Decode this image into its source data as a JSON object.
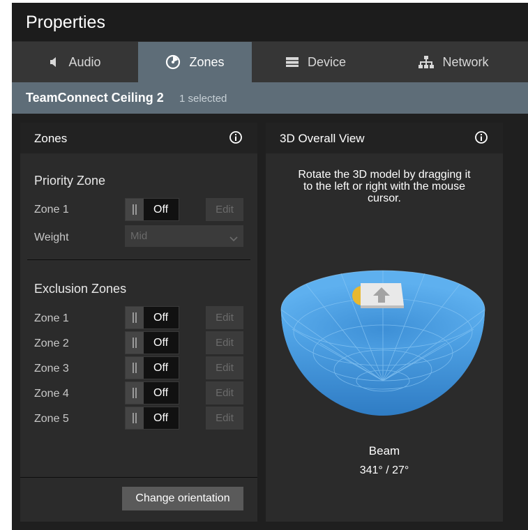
{
  "header": {
    "title": "Properties"
  },
  "tabs": [
    {
      "label": "Audio",
      "icon": "speaker-icon",
      "active": false
    },
    {
      "label": "Zones",
      "icon": "zones-icon",
      "active": true
    },
    {
      "label": "Device",
      "icon": "device-icon",
      "active": false
    },
    {
      "label": "Network",
      "icon": "network-icon",
      "active": false
    }
  ],
  "selection": {
    "device": "TeamConnect Ceiling 2",
    "count": "1 selected"
  },
  "zones_panel": {
    "title": "Zones",
    "priority": {
      "title": "Priority Zone",
      "zone_label": "Zone 1",
      "toggle": "Off",
      "edit": "Edit",
      "weight_label": "Weight",
      "weight_value": "Mid"
    },
    "exclusion": {
      "title": "Exclusion Zones",
      "zones": [
        {
          "label": "Zone 1",
          "toggle": "Off",
          "edit": "Edit"
        },
        {
          "label": "Zone 2",
          "toggle": "Off",
          "edit": "Edit"
        },
        {
          "label": "Zone 3",
          "toggle": "Off",
          "edit": "Edit"
        },
        {
          "label": "Zone 4",
          "toggle": "Off",
          "edit": "Edit"
        },
        {
          "label": "Zone 5",
          "toggle": "Off",
          "edit": "Edit"
        }
      ]
    },
    "change_orientation": "Change orientation"
  },
  "view_panel": {
    "title": "3D Overall View",
    "hint_line1": "Rotate the 3D model by dragging it",
    "hint_line2": "to the left or right with the mouse",
    "hint_line3": "cursor.",
    "beam_label": "Beam",
    "beam_value": "341° / 27°"
  },
  "colors": {
    "accent_tab": "#5e6d78",
    "bowl_blue": "#4a9ee0",
    "beam_marker": "#e8b830"
  }
}
